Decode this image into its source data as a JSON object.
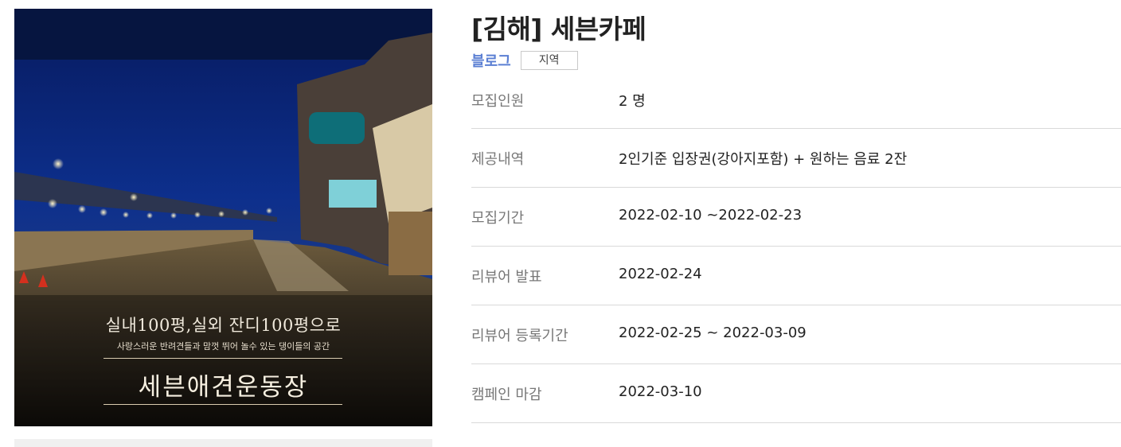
{
  "campaign": {
    "title": "[김해] 세븐카페",
    "channel": "블로그",
    "category": "지역"
  },
  "image": {
    "headline": "실내100평,실외 잔디100평으로",
    "subline": "사랑스러운 반려견들과 맘껏 뛰어 놀수 있는 댕이들의 공간",
    "name": "세븐애견운동장"
  },
  "details": [
    {
      "label": "모집인원",
      "value": "2 명"
    },
    {
      "label": "제공내역",
      "value": "2인기준 입장권(강아지포함) + 원하는 음료 2잔"
    },
    {
      "label": "모집기간",
      "value": "2022-02-10 ~2022-02-23"
    },
    {
      "label": "리뷰어 발표",
      "value": "2022-02-24"
    },
    {
      "label": "리뷰어 등록기간",
      "value": "2022-02-25 ~ 2022-03-09"
    },
    {
      "label": "캠페인 마감",
      "value": "2022-03-10"
    }
  ]
}
